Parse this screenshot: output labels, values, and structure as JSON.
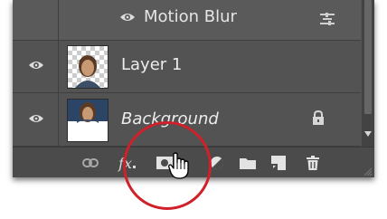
{
  "layers_panel": {
    "effect_row": {
      "label": "Motion Blur",
      "visibility_icon": "eye-icon",
      "options_icon": "filter-blending-options-icon"
    },
    "layers": [
      {
        "name": "Layer 1",
        "visible": true,
        "thumbnail": "portrait-on-transparent"
      },
      {
        "name": "Background",
        "visible": true,
        "locked": true,
        "thumbnail": "portrait-on-white"
      }
    ],
    "toolbar": {
      "fx_label": "fx",
      "tools": [
        "link-layers-icon",
        "fx-icon",
        "add-layer-mask-icon",
        "adjustment-layer-icon",
        "new-group-icon",
        "new-layer-icon",
        "trash-icon"
      ]
    },
    "highlighted_tool": "add-layer-mask-icon"
  },
  "colors": {
    "panel_bg": "#535353",
    "toolbar_bg": "#4b4b4b",
    "highlight_circle": "#d0202a",
    "text": "#ededed"
  }
}
